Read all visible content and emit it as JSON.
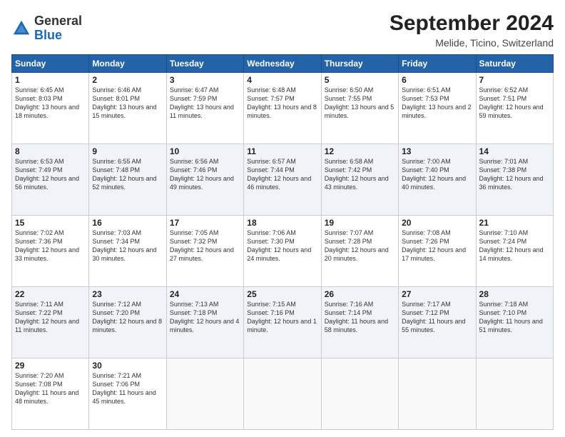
{
  "logo": {
    "general": "General",
    "blue": "Blue"
  },
  "title": "September 2024",
  "location": "Melide, Ticino, Switzerland",
  "days_header": [
    "Sunday",
    "Monday",
    "Tuesday",
    "Wednesday",
    "Thursday",
    "Friday",
    "Saturday"
  ],
  "weeks": [
    [
      {
        "num": "1",
        "rise": "6:45 AM",
        "set": "8:03 PM",
        "daylight": "13 hours and 18 minutes."
      },
      {
        "num": "2",
        "rise": "6:46 AM",
        "set": "8:01 PM",
        "daylight": "13 hours and 15 minutes."
      },
      {
        "num": "3",
        "rise": "6:47 AM",
        "set": "7:59 PM",
        "daylight": "13 hours and 11 minutes."
      },
      {
        "num": "4",
        "rise": "6:48 AM",
        "set": "7:57 PM",
        "daylight": "13 hours and 8 minutes."
      },
      {
        "num": "5",
        "rise": "6:50 AM",
        "set": "7:55 PM",
        "daylight": "13 hours and 5 minutes."
      },
      {
        "num": "6",
        "rise": "6:51 AM",
        "set": "7:53 PM",
        "daylight": "13 hours and 2 minutes."
      },
      {
        "num": "7",
        "rise": "6:52 AM",
        "set": "7:51 PM",
        "daylight": "12 hours and 59 minutes."
      }
    ],
    [
      {
        "num": "8",
        "rise": "6:53 AM",
        "set": "7:49 PM",
        "daylight": "12 hours and 56 minutes."
      },
      {
        "num": "9",
        "rise": "6:55 AM",
        "set": "7:48 PM",
        "daylight": "12 hours and 52 minutes."
      },
      {
        "num": "10",
        "rise": "6:56 AM",
        "set": "7:46 PM",
        "daylight": "12 hours and 49 minutes."
      },
      {
        "num": "11",
        "rise": "6:57 AM",
        "set": "7:44 PM",
        "daylight": "12 hours and 46 minutes."
      },
      {
        "num": "12",
        "rise": "6:58 AM",
        "set": "7:42 PM",
        "daylight": "12 hours and 43 minutes."
      },
      {
        "num": "13",
        "rise": "7:00 AM",
        "set": "7:40 PM",
        "daylight": "12 hours and 40 minutes."
      },
      {
        "num": "14",
        "rise": "7:01 AM",
        "set": "7:38 PM",
        "daylight": "12 hours and 36 minutes."
      }
    ],
    [
      {
        "num": "15",
        "rise": "7:02 AM",
        "set": "7:36 PM",
        "daylight": "12 hours and 33 minutes."
      },
      {
        "num": "16",
        "rise": "7:03 AM",
        "set": "7:34 PM",
        "daylight": "12 hours and 30 minutes."
      },
      {
        "num": "17",
        "rise": "7:05 AM",
        "set": "7:32 PM",
        "daylight": "12 hours and 27 minutes."
      },
      {
        "num": "18",
        "rise": "7:06 AM",
        "set": "7:30 PM",
        "daylight": "12 hours and 24 minutes."
      },
      {
        "num": "19",
        "rise": "7:07 AM",
        "set": "7:28 PM",
        "daylight": "12 hours and 20 minutes."
      },
      {
        "num": "20",
        "rise": "7:08 AM",
        "set": "7:26 PM",
        "daylight": "12 hours and 17 minutes."
      },
      {
        "num": "21",
        "rise": "7:10 AM",
        "set": "7:24 PM",
        "daylight": "12 hours and 14 minutes."
      }
    ],
    [
      {
        "num": "22",
        "rise": "7:11 AM",
        "set": "7:22 PM",
        "daylight": "12 hours and 11 minutes."
      },
      {
        "num": "23",
        "rise": "7:12 AM",
        "set": "7:20 PM",
        "daylight": "12 hours and 8 minutes."
      },
      {
        "num": "24",
        "rise": "7:13 AM",
        "set": "7:18 PM",
        "daylight": "12 hours and 4 minutes."
      },
      {
        "num": "25",
        "rise": "7:15 AM",
        "set": "7:16 PM",
        "daylight": "12 hours and 1 minute."
      },
      {
        "num": "26",
        "rise": "7:16 AM",
        "set": "7:14 PM",
        "daylight": "11 hours and 58 minutes."
      },
      {
        "num": "27",
        "rise": "7:17 AM",
        "set": "7:12 PM",
        "daylight": "11 hours and 55 minutes."
      },
      {
        "num": "28",
        "rise": "7:18 AM",
        "set": "7:10 PM",
        "daylight": "11 hours and 51 minutes."
      }
    ],
    [
      {
        "num": "29",
        "rise": "7:20 AM",
        "set": "7:08 PM",
        "daylight": "11 hours and 48 minutes."
      },
      {
        "num": "30",
        "rise": "7:21 AM",
        "set": "7:06 PM",
        "daylight": "11 hours and 45 minutes."
      },
      null,
      null,
      null,
      null,
      null
    ]
  ]
}
